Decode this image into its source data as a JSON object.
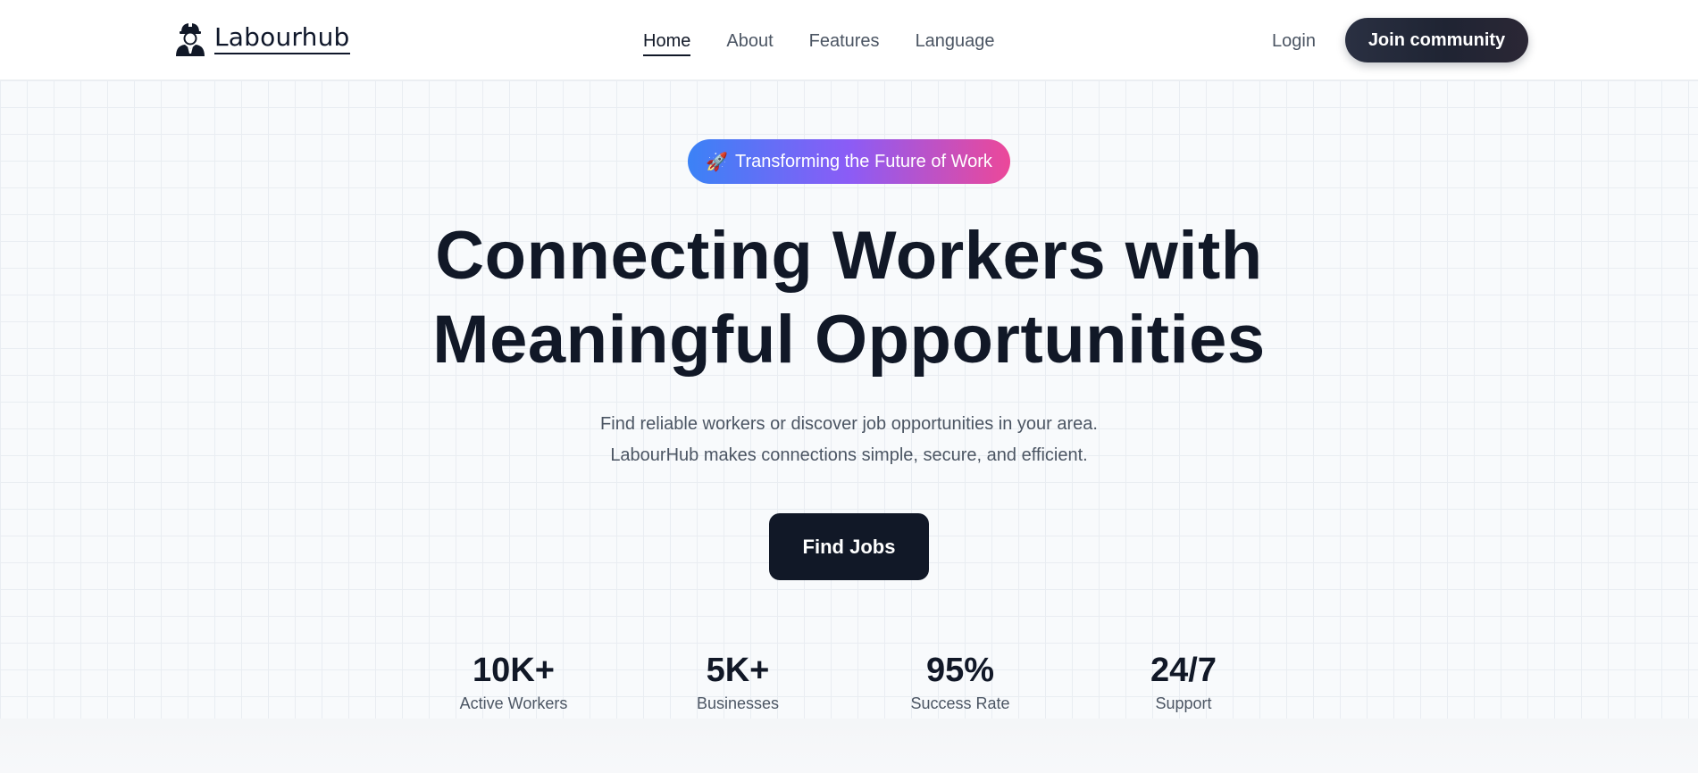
{
  "navbar": {
    "logo_text": "Labourhub",
    "links": [
      {
        "label": "Home",
        "active": true
      },
      {
        "label": "About",
        "active": false
      },
      {
        "label": "Features",
        "active": false
      },
      {
        "label": "Language",
        "active": false
      }
    ],
    "login_label": "Login",
    "join_label": "Join community"
  },
  "hero": {
    "badge_icon": "🚀",
    "badge_text": "Transforming the Future of Work",
    "headline_line1": "Connecting Workers with",
    "headline_line2": "Meaningful Opportunities",
    "subtitle_line1": "Find reliable workers or discover job opportunities in your area.",
    "subtitle_line2": "LabourHub makes connections simple, secure, and efficient.",
    "cta_label": "Find Jobs"
  },
  "stats": [
    {
      "value": "10K+",
      "label": "Active Workers"
    },
    {
      "value": "5K+",
      "label": "Businesses"
    },
    {
      "value": "95%",
      "label": "Success Rate"
    },
    {
      "value": "24/7",
      "label": "Support"
    }
  ],
  "colors": {
    "primary_dark": "#111827",
    "badge_gradient": [
      "#3b82f6",
      "#8b5cf6",
      "#ec4899"
    ],
    "muted_text": "#4b5563"
  },
  "icons": {
    "logo": "worker-hardhat-icon",
    "badge": "rocket-icon"
  }
}
